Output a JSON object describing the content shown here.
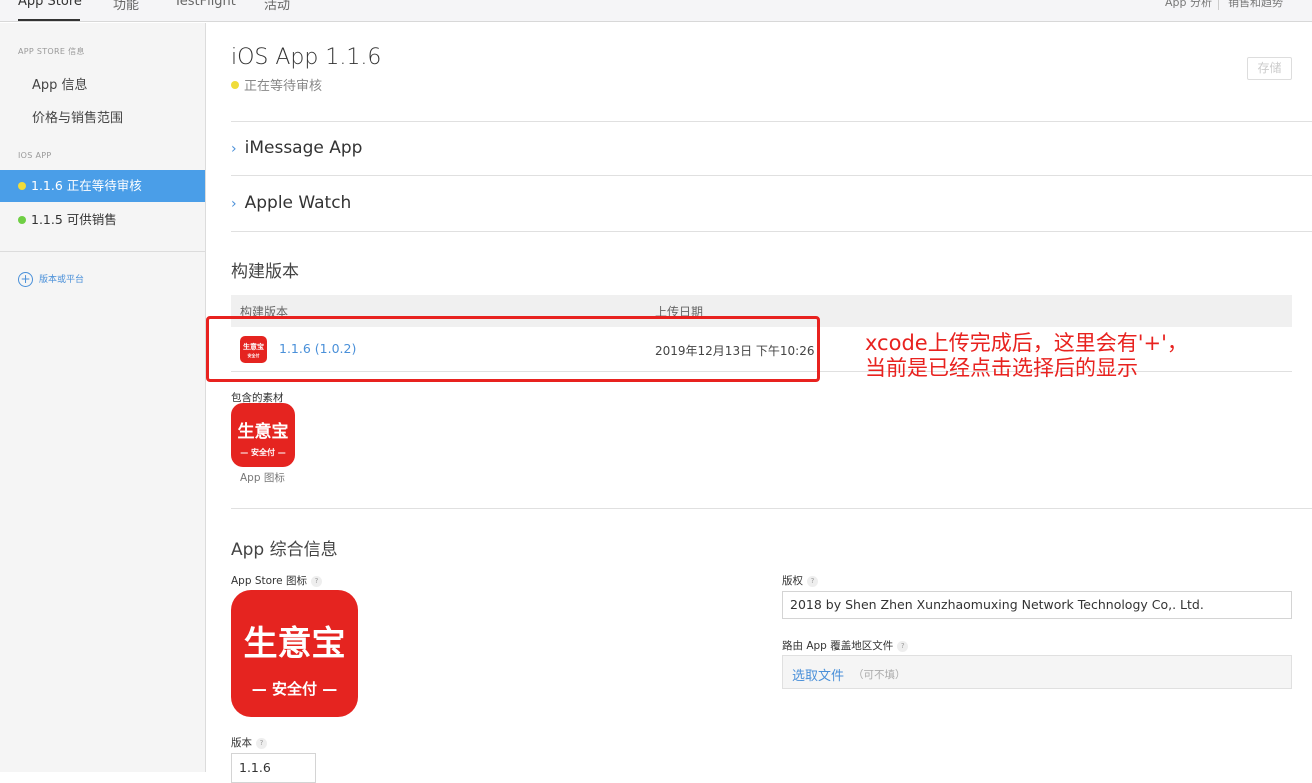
{
  "topnav": {
    "tabs": [
      "App Store",
      "功能",
      "TestFlight",
      "活动"
    ],
    "right_links": [
      "App 分析",
      "销售和趋势"
    ]
  },
  "sidebar": {
    "section_app_store": "APP STORE 信息",
    "items": [
      "App 信息",
      "价格与销售范围"
    ],
    "section_ios": "IOS APP",
    "versions": [
      {
        "label": "1.1.6 正在等待审核",
        "status_color": "#f0dc3a"
      },
      {
        "label": "1.1.5 可供销售",
        "status_color": "#6fcf44"
      }
    ],
    "add_label": "版本或平台"
  },
  "main": {
    "title": "iOS App 1.1.6",
    "status": "正在等待审核",
    "save_label": "存储",
    "expanders": [
      "iMessage App",
      "Apple Watch"
    ],
    "build_section_title": "构建版本",
    "build_table": {
      "headers": [
        "构建版本",
        "上传日期"
      ],
      "rows": [
        {
          "version": "1.1.6 (1.0.2)",
          "date": "2019年12月13日 下午10:26"
        }
      ]
    },
    "assets_label": "包含的素材",
    "app_icon_caption": "App 图标",
    "icon_text": {
      "top": "生意宝",
      "bottom": "— 安全付 —",
      "top_small": "生意宝",
      "bottom_small": "安全付"
    },
    "general_section_title": "App 综合信息",
    "app_store_icon_label": "App Store 图标",
    "version_label": "版本",
    "version_value": "1.1.6",
    "copyright_label": "版权",
    "copyright_value": "2018 by Shen Zhen Xunzhaomuxing Network Technology Co,. Ltd.",
    "routing_label": "路由 App 覆盖地区文件",
    "choose_file": "选取文件",
    "optional_hint": "（可不填）",
    "help_glyph": "?"
  },
  "annotation": {
    "line1": "xcode上传完成后，这里会有'+'，",
    "line2": "当前是已经点击选择后的显示",
    "color": "#e8221f"
  }
}
